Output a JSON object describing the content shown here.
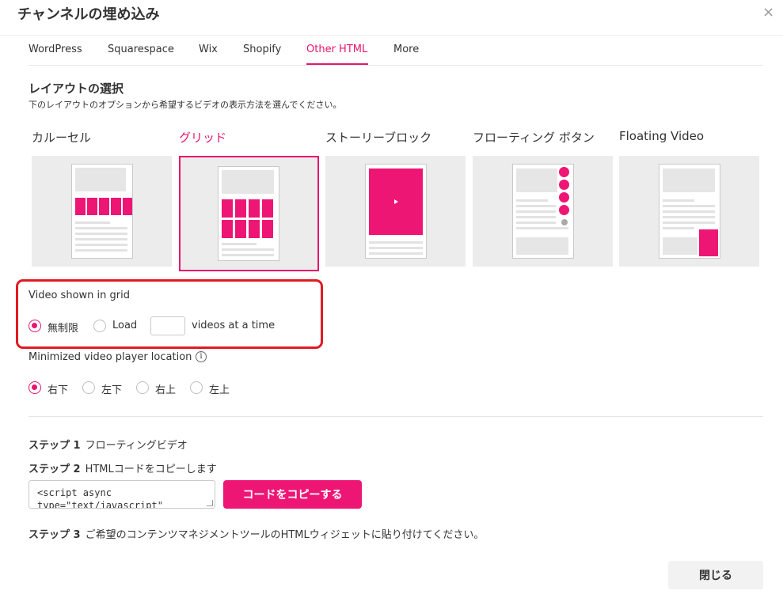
{
  "dialog": {
    "title": "チャンネルの埋め込み",
    "close_icon": "×"
  },
  "tabs": [
    {
      "label": "WordPress"
    },
    {
      "label": "Squarespace"
    },
    {
      "label": "Wix"
    },
    {
      "label": "Shopify"
    },
    {
      "label": "Other HTML",
      "active": true
    },
    {
      "label": "More"
    }
  ],
  "layout_section": {
    "title": "レイアウトの選択",
    "subtitle": "下のレイアウトのオプションから希望するビデオの表示方法を選んでください。",
    "options": [
      {
        "label": "カルーセル",
        "icon": "carousel-preview"
      },
      {
        "label": "グリッド",
        "icon": "grid-preview",
        "selected": true
      },
      {
        "label": "ストーリーブロック",
        "icon": "story-block-preview"
      },
      {
        "label": "フローティング ボタン",
        "icon": "floating-button-preview"
      },
      {
        "label": "Floating Video",
        "icon": "floating-video-preview"
      }
    ]
  },
  "grid_options": {
    "title": "Video shown in grid",
    "unlimited_label": "無制限",
    "load_label": "Load",
    "load_value": "",
    "suffix_label": "videos at a time",
    "selected": "unlimited"
  },
  "player_location": {
    "title": "Minimized video player location",
    "info_icon": "i",
    "options": [
      "右下",
      "左下",
      "右上",
      "左上"
    ],
    "selected": "右下"
  },
  "steps": {
    "step1_prefix": "ステップ 1",
    "step1_text": "フローティングビデオ",
    "step2_prefix": "ステップ 2",
    "step2_text": "HTMLコードをコピーします",
    "code_line1": "<script async",
    "code_line2": "type=\"text/javascript\"",
    "copy_button": "コードをコピーする",
    "step3_prefix": "ステップ 3",
    "step3_text": "ご希望のコンテンツマネジメントツールのHTMLウィジェットに貼り付けてください。"
  },
  "footer": {
    "close_button": "閉じる"
  },
  "colors": {
    "accent": "#e6166e",
    "highlight_border": "#e01b24"
  }
}
